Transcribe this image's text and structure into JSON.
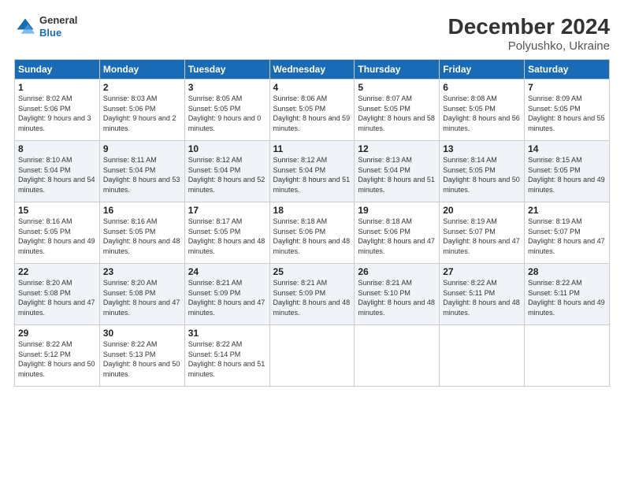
{
  "logo": {
    "general": "General",
    "blue": "Blue"
  },
  "title": "December 2024",
  "subtitle": "Polyushko, Ukraine",
  "days_header": [
    "Sunday",
    "Monday",
    "Tuesday",
    "Wednesday",
    "Thursday",
    "Friday",
    "Saturday"
  ],
  "weeks": [
    [
      {
        "day": "1",
        "sunrise": "8:02 AM",
        "sunset": "5:06 PM",
        "daylight": "9 hours and 3 minutes."
      },
      {
        "day": "2",
        "sunrise": "8:03 AM",
        "sunset": "5:06 PM",
        "daylight": "9 hours and 2 minutes."
      },
      {
        "day": "3",
        "sunrise": "8:05 AM",
        "sunset": "5:05 PM",
        "daylight": "9 hours and 0 minutes."
      },
      {
        "day": "4",
        "sunrise": "8:06 AM",
        "sunset": "5:05 PM",
        "daylight": "8 hours and 59 minutes."
      },
      {
        "day": "5",
        "sunrise": "8:07 AM",
        "sunset": "5:05 PM",
        "daylight": "8 hours and 58 minutes."
      },
      {
        "day": "6",
        "sunrise": "8:08 AM",
        "sunset": "5:05 PM",
        "daylight": "8 hours and 56 minutes."
      },
      {
        "day": "7",
        "sunrise": "8:09 AM",
        "sunset": "5:05 PM",
        "daylight": "8 hours and 55 minutes."
      }
    ],
    [
      {
        "day": "8",
        "sunrise": "8:10 AM",
        "sunset": "5:04 PM",
        "daylight": "8 hours and 54 minutes."
      },
      {
        "day": "9",
        "sunrise": "8:11 AM",
        "sunset": "5:04 PM",
        "daylight": "8 hours and 53 minutes."
      },
      {
        "day": "10",
        "sunrise": "8:12 AM",
        "sunset": "5:04 PM",
        "daylight": "8 hours and 52 minutes."
      },
      {
        "day": "11",
        "sunrise": "8:12 AM",
        "sunset": "5:04 PM",
        "daylight": "8 hours and 51 minutes."
      },
      {
        "day": "12",
        "sunrise": "8:13 AM",
        "sunset": "5:04 PM",
        "daylight": "8 hours and 51 minutes."
      },
      {
        "day": "13",
        "sunrise": "8:14 AM",
        "sunset": "5:05 PM",
        "daylight": "8 hours and 50 minutes."
      },
      {
        "day": "14",
        "sunrise": "8:15 AM",
        "sunset": "5:05 PM",
        "daylight": "8 hours and 49 minutes."
      }
    ],
    [
      {
        "day": "15",
        "sunrise": "8:16 AM",
        "sunset": "5:05 PM",
        "daylight": "8 hours and 49 minutes."
      },
      {
        "day": "16",
        "sunrise": "8:16 AM",
        "sunset": "5:05 PM",
        "daylight": "8 hours and 48 minutes."
      },
      {
        "day": "17",
        "sunrise": "8:17 AM",
        "sunset": "5:05 PM",
        "daylight": "8 hours and 48 minutes."
      },
      {
        "day": "18",
        "sunrise": "8:18 AM",
        "sunset": "5:06 PM",
        "daylight": "8 hours and 48 minutes."
      },
      {
        "day": "19",
        "sunrise": "8:18 AM",
        "sunset": "5:06 PM",
        "daylight": "8 hours and 47 minutes."
      },
      {
        "day": "20",
        "sunrise": "8:19 AM",
        "sunset": "5:07 PM",
        "daylight": "8 hours and 47 minutes."
      },
      {
        "day": "21",
        "sunrise": "8:19 AM",
        "sunset": "5:07 PM",
        "daylight": "8 hours and 47 minutes."
      }
    ],
    [
      {
        "day": "22",
        "sunrise": "8:20 AM",
        "sunset": "5:08 PM",
        "daylight": "8 hours and 47 minutes."
      },
      {
        "day": "23",
        "sunrise": "8:20 AM",
        "sunset": "5:08 PM",
        "daylight": "8 hours and 47 minutes."
      },
      {
        "day": "24",
        "sunrise": "8:21 AM",
        "sunset": "5:09 PM",
        "daylight": "8 hours and 47 minutes."
      },
      {
        "day": "25",
        "sunrise": "8:21 AM",
        "sunset": "5:09 PM",
        "daylight": "8 hours and 48 minutes."
      },
      {
        "day": "26",
        "sunrise": "8:21 AM",
        "sunset": "5:10 PM",
        "daylight": "8 hours and 48 minutes."
      },
      {
        "day": "27",
        "sunrise": "8:22 AM",
        "sunset": "5:11 PM",
        "daylight": "8 hours and 48 minutes."
      },
      {
        "day": "28",
        "sunrise": "8:22 AM",
        "sunset": "5:11 PM",
        "daylight": "8 hours and 49 minutes."
      }
    ],
    [
      {
        "day": "29",
        "sunrise": "8:22 AM",
        "sunset": "5:12 PM",
        "daylight": "8 hours and 50 minutes."
      },
      {
        "day": "30",
        "sunrise": "8:22 AM",
        "sunset": "5:13 PM",
        "daylight": "8 hours and 50 minutes."
      },
      {
        "day": "31",
        "sunrise": "8:22 AM",
        "sunset": "5:14 PM",
        "daylight": "8 hours and 51 minutes."
      },
      null,
      null,
      null,
      null
    ]
  ]
}
